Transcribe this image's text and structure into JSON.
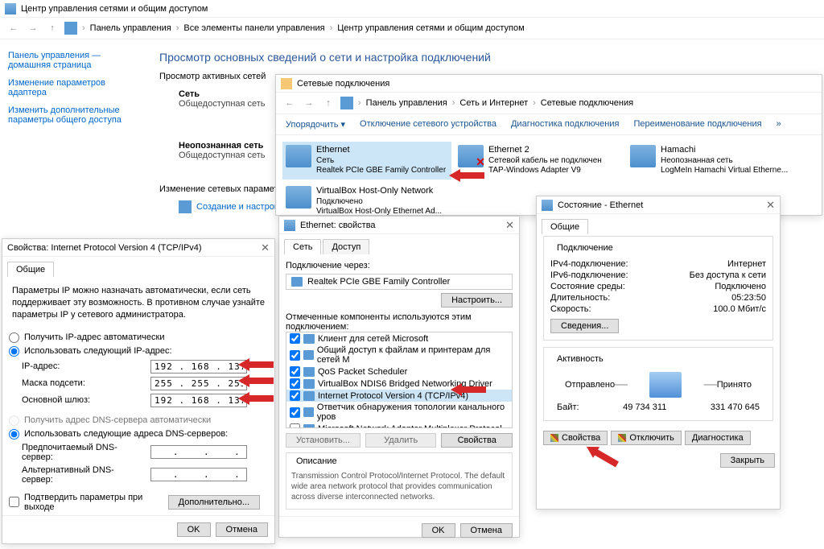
{
  "ncpa_main": {
    "title": "Центр управления сетями и общим доступом",
    "breadcrumbs": [
      "Панель управления",
      "Все элементы панели управления",
      "Центр управления сетями и общим доступом"
    ],
    "sidebar": [
      "Панель управления — домашняя страница",
      "Изменение параметров адаптера",
      "Изменить дополнительные параметры общего доступа"
    ],
    "heading": "Просмотр основных сведений о сети и настройка подключений",
    "active_label": "Просмотр активных сетей",
    "net1_name": "Сеть",
    "net1_sub": "Общедоступная сеть",
    "net2_name": "Неопознанная сеть",
    "net2_sub": "Общедоступная сеть",
    "change_label": "Изменение сетевых параметров",
    "create_link": "Создание и настройка"
  },
  "conn_window": {
    "title": "Сетевые подключения",
    "breadcrumbs": [
      "Панель управления",
      "Сеть и Интернет",
      "Сетевые подключения"
    ],
    "toolbar": {
      "organize": "Упорядочить",
      "disable": "Отключение сетевого устройства",
      "diagnose": "Диагностика подключения",
      "rename": "Переименование подключения"
    },
    "items": [
      {
        "name": "Ethernet",
        "line2": "Сеть",
        "line3": "Realtek PCIe GBE Family Controller",
        "selected": true,
        "disabled": false
      },
      {
        "name": "Ethernet 2",
        "line2": "Сетевой кабель не подключен",
        "line3": "TAP-Windows Adapter V9",
        "selected": false,
        "disabled": true
      },
      {
        "name": "Hamachi",
        "line2": "Неопознанная сеть",
        "line3": "LogMeIn Hamachi Virtual Etherne...",
        "selected": false,
        "disabled": false
      },
      {
        "name": "VirtualBox Host-Only Network",
        "line2": "Подключено",
        "line3": "VirtualBox Host-Only Ethernet Ad...",
        "selected": false,
        "disabled": false
      }
    ]
  },
  "status_dlg": {
    "title": "Состояние - Ethernet",
    "tab": "Общие",
    "connection_group": "Подключение",
    "ipv4_label": "IPv4-подключение:",
    "ipv4_value": "Интернет",
    "ipv6_label": "IPv6-подключение:",
    "ipv6_value": "Без доступа к сети",
    "media_label": "Состояние среды:",
    "media_value": "Подключено",
    "duration_label": "Длительность:",
    "duration_value": "05:23:50",
    "speed_label": "Скорость:",
    "speed_value": "100.0 Мбит/с",
    "details_btn": "Сведения...",
    "activity_group": "Активность",
    "sent_label": "Отправлено",
    "recv_label": "Принято",
    "bytes_label": "Байт:",
    "sent_bytes": "49 734 311",
    "recv_bytes": "331 470 645",
    "props_btn": "Свойства",
    "disable_btn": "Отключить",
    "diag_btn": "Диагностика",
    "close_btn": "Закрыть"
  },
  "eth_props": {
    "title": "Ethernet: свойства",
    "tab_net": "Сеть",
    "tab_access": "Доступ",
    "connect_via": "Подключение через:",
    "adapter": "Realtek PCIe GBE Family Controller",
    "configure_btn": "Настроить...",
    "components_label": "Отмеченные компоненты используются этим подключением:",
    "components": [
      "Клиент для сетей Microsoft",
      "Общий доступ к файлам и принтерам для сетей M",
      "QoS Packet Scheduler",
      "VirtualBox NDIS6 Bridged Networking Driver",
      "Internet Protocol Version 4 (TCP/IPv4)",
      "Ответчик обнаружения топологии канального уров",
      "Microsoft Network Adapter Multiplexor Protocol"
    ],
    "install_btn": "Установить...",
    "uninstall_btn": "Удалить",
    "props_btn": "Свойства",
    "desc_label": "Описание",
    "desc_text": "Transmission Control Protocol/Internet Protocol. The default wide area network protocol that provides communication across diverse interconnected networks.",
    "ok": "OK",
    "cancel": "Отмена"
  },
  "ipv4_dlg": {
    "title": "Свойства: Internet Protocol Version 4 (TCP/IPv4)",
    "tab": "Общие",
    "intro": "Параметры IP можно назначать автоматически, если сеть поддерживает эту возможность. В противном случае узнайте параметры IP у сетевого администратора.",
    "radio_auto_ip": "Получить IP-адрес автоматически",
    "radio_manual_ip": "Использовать следующий IP-адрес:",
    "ip_label": "IP-адрес:",
    "ip_value": "192 . 168 . 137 .   2",
    "mask_label": "Маска подсети:",
    "mask_value": "255 . 255 . 255 .   0",
    "gw_label": "Основной шлюз:",
    "gw_value": "192 . 168 . 137 .   1",
    "radio_auto_dns": "Получить адрес DNS-сервера автоматически",
    "radio_manual_dns": "Использовать следующие адреса DNS-серверов:",
    "dns1_label": "Предпочитаемый DNS-сервер:",
    "dns1_value": "   .    .    .   ",
    "dns2_label": "Альтернативный DNS-сервер:",
    "dns2_value": "   .    .    .   ",
    "validate_check": "Подтвердить параметры при выходе",
    "advanced_btn": "Дополнительно...",
    "ok": "OK",
    "cancel": "Отмена"
  }
}
